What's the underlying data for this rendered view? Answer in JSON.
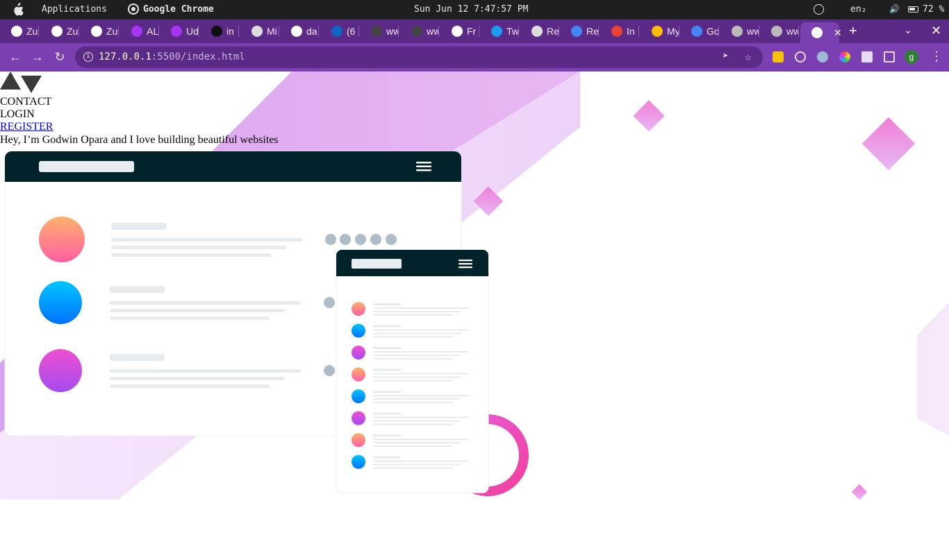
{
  "os": {
    "menu_apps": "Applications",
    "app_name": "Google Chrome",
    "clock": "Sun Jun 12  7:47:57 PM",
    "lang": "en₂",
    "battery": "72 %"
  },
  "tabs": [
    {
      "label": "Zu",
      "icon": "globe-icon",
      "color": "#ffffff"
    },
    {
      "label": "Zu",
      "icon": "globe-icon",
      "color": "#ffffff"
    },
    {
      "label": "Zu",
      "icon": "globe-icon",
      "color": "#ffffff"
    },
    {
      "label": "AL",
      "icon": "udemy-icon",
      "color": "#a435f0"
    },
    {
      "label": "Ud",
      "icon": "udemy-icon",
      "color": "#a435f0"
    },
    {
      "label": "in",
      "icon": "chatgpt-icon",
      "color": "#111111"
    },
    {
      "label": "Mi",
      "icon": "moon-icon",
      "color": "#dddddd"
    },
    {
      "label": "da",
      "icon": "globe-icon",
      "color": "#ffffff"
    },
    {
      "label": "(6",
      "icon": "linkedin-icon",
      "color": "#0a66c2"
    },
    {
      "label": "ww",
      "icon": "linkedin-icon",
      "color": "#444444"
    },
    {
      "label": "ww",
      "icon": "linkedin-icon",
      "color": "#444444"
    },
    {
      "label": "Fr",
      "icon": "globe-icon",
      "color": "#ffffff"
    },
    {
      "label": "Tw",
      "icon": "twitter-icon",
      "color": "#1d9bf0"
    },
    {
      "label": "Re",
      "icon": "reader-icon",
      "color": "#dddddd"
    },
    {
      "label": "Re",
      "icon": "docs-icon",
      "color": "#4285f4"
    },
    {
      "label": "In",
      "icon": "gmail-icon",
      "color": "#ea4335"
    },
    {
      "label": "My",
      "icon": "drive-icon",
      "color": "#fbbc04"
    },
    {
      "label": "Go",
      "icon": "docs-icon",
      "color": "#4285f4"
    },
    {
      "label": "ww",
      "icon": "globe-icon",
      "color": "#bbbbbb"
    },
    {
      "label": "ww",
      "icon": "globe-icon",
      "color": "#bbbbbb"
    }
  ],
  "active_tab": {
    "close_label": "✕",
    "icon": "globe-icon"
  },
  "toolbar": {
    "url_host": "127.0.0.1",
    "url_path": ":5500/index.html"
  },
  "page": {
    "nav": {
      "contact": "CONTACT",
      "login": "LOGIN",
      "register": "REGISTER"
    },
    "hero_text": "Hey, I’m Godwin Opara and I love building beautiful websites"
  },
  "colors": {
    "chrome_tabstrip": "#5b2a86",
    "chrome_toolbar": "#7a3fb0",
    "illus_header": "#022329",
    "accent_pink": "#e056fd",
    "accent_orange": "#ff9a76",
    "accent_blue": "#00a8ff"
  }
}
